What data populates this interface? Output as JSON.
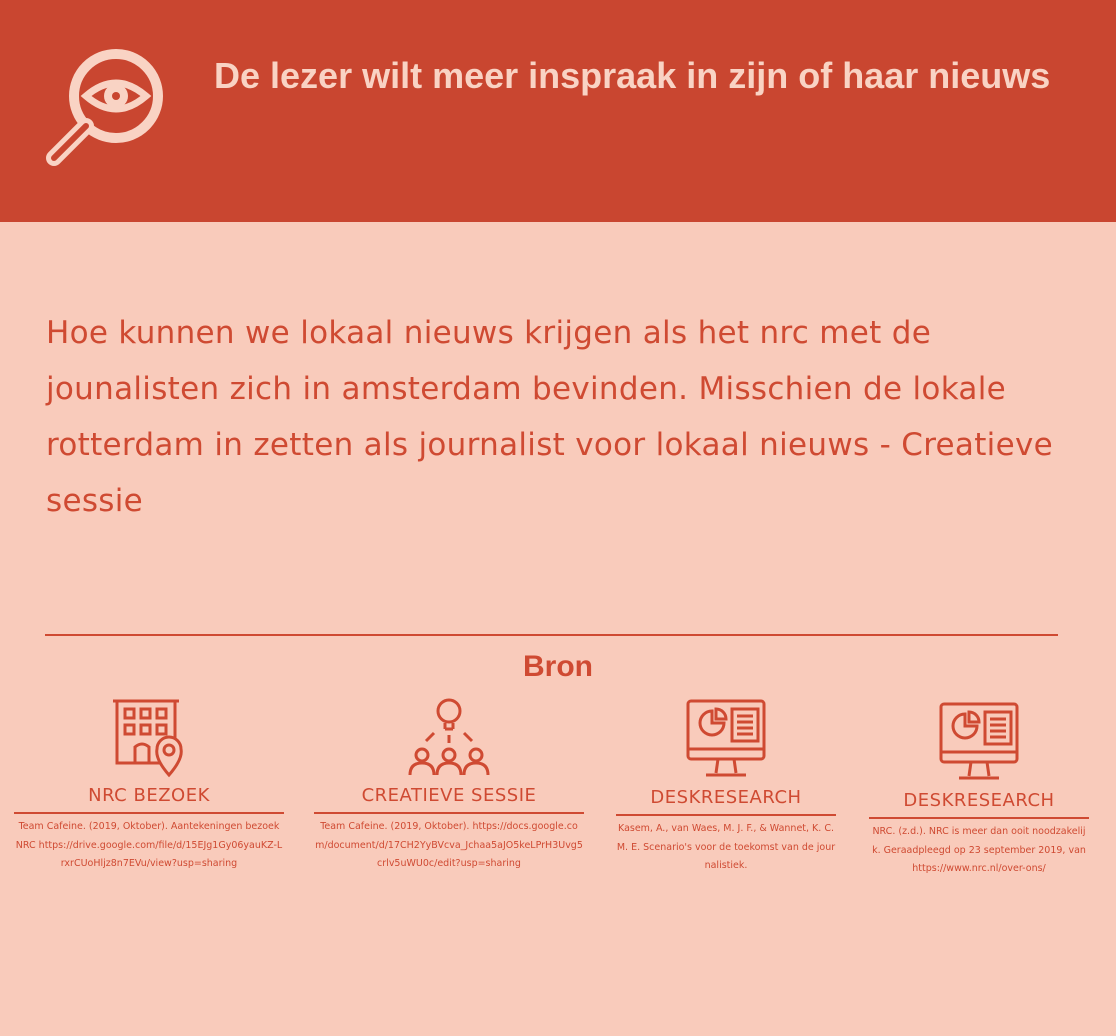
{
  "header": {
    "icon": "magnifier-eye-icon",
    "title": "De lezer wilt meer inspraak in zijn of haar nieuws"
  },
  "main": {
    "text": "Hoe kunnen we lokaal nieuws krijgen als het nrc met de jounalisten zich in amsterdam bevinden. Misschien de lokale rotterdam in zetten als journalist voor lokaal nieuws - Creatieve sessie"
  },
  "colors": {
    "header_bg": "#c94630",
    "page_bg": "#f9cbbb",
    "accent": "#cf4a32",
    "header_text": "#f9d3c4"
  },
  "bron": {
    "title": "Bron",
    "sources": [
      {
        "icon": "building-location-icon",
        "label": "NRC BEZOEK",
        "ref": "Team Cafeine. (2019, Oktober). Aantekeningen bezoek NRC https://drive.google.com/file/d/15EJg1Gy06yauKZ-LrxrCUoHljz8n7EVu/view?usp=sharing"
      },
      {
        "icon": "team-idea-icon",
        "label": "CREATIEVE SESSIE",
        "ref": "Team Cafeine. (2019, Oktober). https://docs.google.com/document/d/17CH2YyBVcva_Jchaa5aJO5keLPrH3Uvg5crlv5uWU0c/edit?usp=sharing"
      },
      {
        "icon": "monitor-chart-icon",
        "label": "DESKRESEARCH",
        "ref": "Kasem, A., van Waes, M. J. F., & Wannet, K. C. M. E. Scenario's voor de toekomst van de journalistiek."
      },
      {
        "icon": "monitor-chart-icon",
        "label": "DESKRESEARCH",
        "ref": "NRC. (z.d.). NRC is meer dan ooit noodzakelijk. Geraadpleegd op 23 september 2019, van https://www.nrc.nl/over-ons/"
      }
    ]
  }
}
